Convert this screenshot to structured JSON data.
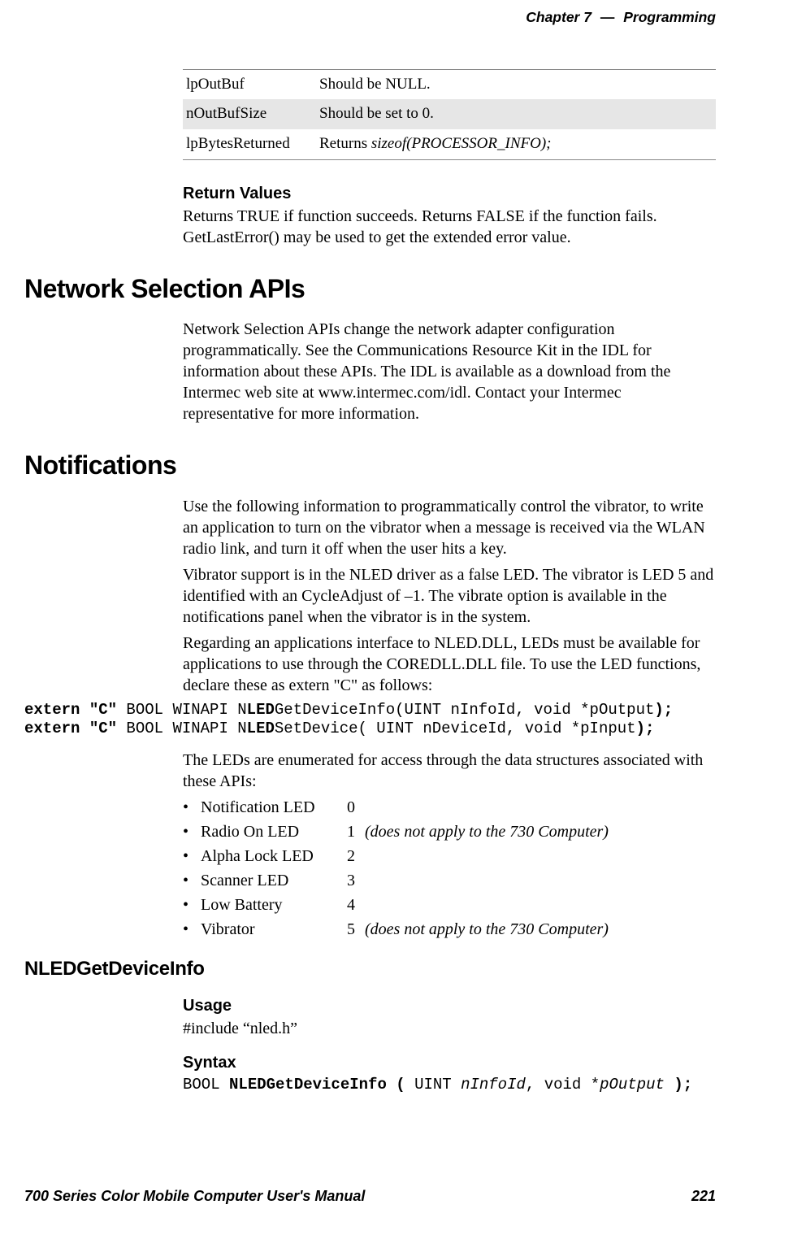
{
  "header": {
    "chapter_label": "Chapter 7",
    "separator": "—",
    "chapter_title": "Programming"
  },
  "params_table": {
    "rows": [
      {
        "name": "lpOutBuf",
        "desc": "Should be NULL."
      },
      {
        "name": "nOutBufSize",
        "desc": "Should be set to 0."
      },
      {
        "name": "lpBytesReturned",
        "desc_prefix": "Returns ",
        "desc_italic": "sizeof(PROCESSOR_INFO);"
      }
    ]
  },
  "return_values": {
    "heading": "Return Values",
    "text": "Returns TRUE if function succeeds. Returns FALSE if the function fails. GetLastError() may be used to get the extended error value."
  },
  "network_selection": {
    "heading": "Network Selection APIs",
    "text": "Network Selection APIs change the network adapter configuration programmatically. See the Communications Resource Kit in the IDL for information about these APIs. The IDL is available as a download from the Intermec web site at www.intermec.com/idl. Contact your Intermec representative for more information."
  },
  "notifications": {
    "heading": "Notifications",
    "p1": "Use the following information to programmatically control the vibrator, to write an application to turn on the vibrator when a message is received via the WLAN radio link, and turn it off when the user hits a key.",
    "p2": "Vibrator support is in the NLED driver as a false LED. The vibrator is LED 5 and identified with an CycleAdjust of –1. The vibrate option is available in the notifications panel when the vibrator is in the system.",
    "p3": "Regarding an applications interface to NLED.DLL, LEDs must be available for applications to use through the COREDLL.DLL file. To use the LED functions, declare these as extern \"C\" as follows:",
    "code": {
      "l1_a": "extern \"C\"",
      "l1_b": " BOOL WINAPI N",
      "l1_c": "LED",
      "l1_d": "GetDeviceInfo(UINT nInfoId, void *pOutput",
      "l1_e": ");",
      "l2_a": "extern \"C\"",
      "l2_b": " BOOL WINAPI N",
      "l2_c": "LED",
      "l2_d": "SetDevice( UINT nDeviceId, void *pInput",
      "l2_e": ");"
    },
    "p4": "The LEDs are enumerated for access through the data structures associated with these APIs:",
    "led_list": [
      {
        "name": "Notification LED",
        "num": "0",
        "note": ""
      },
      {
        "name": "Radio On LED",
        "num": "1",
        "note": "(does not apply to the 730 Computer)"
      },
      {
        "name": "Alpha Lock LED",
        "num": "2",
        "note": ""
      },
      {
        "name": "Scanner LED",
        "num": "3",
        "note": ""
      },
      {
        "name": "Low Battery",
        "num": "4",
        "note": ""
      },
      {
        "name": "Vibrator",
        "num": "5",
        "note": "(does not apply to the 730 Computer)"
      }
    ]
  },
  "nled_get": {
    "heading": "NLEDGetDeviceInfo",
    "usage_h": "Usage",
    "usage_t": "#include “nled.h”",
    "syntax_h": "Syntax",
    "syntax": {
      "a": "BOOL ",
      "b": "NLEDGetDeviceInfo ( ",
      "c": "UINT ",
      "d": "nInfoId",
      "e": ", void *",
      "f": "pOutput",
      "g": " );"
    }
  },
  "footer": {
    "left": "700 Series Color Mobile Computer User's Manual",
    "right": "221"
  }
}
